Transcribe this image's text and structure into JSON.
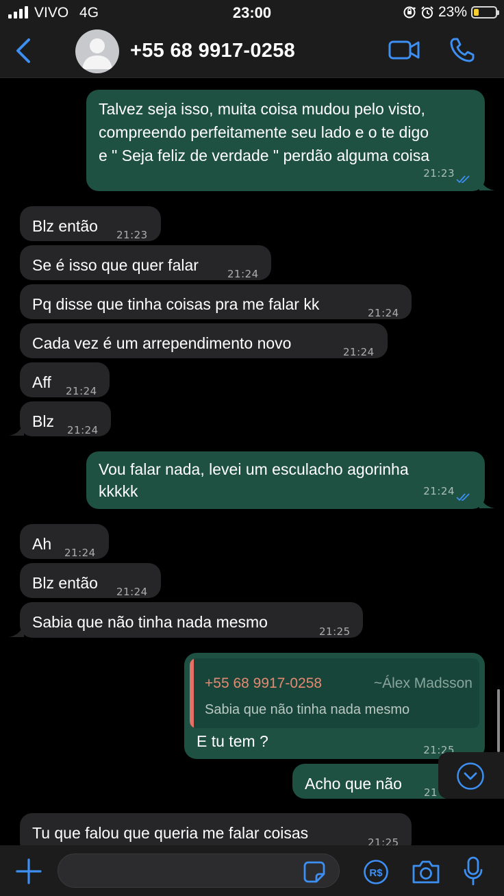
{
  "status_bar": {
    "carrier": "VIVO",
    "network": "4G",
    "time": "23:00",
    "battery_percent_text": "23%",
    "battery_level": 0.23,
    "icons": [
      "signal-icon",
      "orientation-lock-icon",
      "alarm-icon",
      "battery-icon"
    ]
  },
  "header": {
    "contact": "+55 68 9917-0258",
    "icons": [
      "back-icon",
      "avatar",
      "video-call-icon",
      "voice-call-icon"
    ]
  },
  "messages": [
    {
      "dir": "out",
      "lines": [
        "Talvez seja isso, muita coisa mudou pelo visto,",
        "compreendo perfeitamente seu lado e o te digo",
        "e \" Seja feliz de verdade \" perdão alguma coisa"
      ],
      "time": "21:23"
    },
    {
      "dir": "in",
      "lines": [
        "Blz então"
      ],
      "time": "21:23"
    },
    {
      "dir": "in",
      "lines": [
        "Se é isso que quer falar"
      ],
      "time": "21:24"
    },
    {
      "dir": "in",
      "lines": [
        "Pq disse que tinha coisas pra me falar kk"
      ],
      "time": "21:24"
    },
    {
      "dir": "in",
      "lines": [
        "Cada vez é um arrependimento novo"
      ],
      "time": "21:24"
    },
    {
      "dir": "in",
      "lines": [
        "Aff"
      ],
      "time": "21:24"
    },
    {
      "dir": "in",
      "lines": [
        "Blz"
      ],
      "time": "21:24"
    },
    {
      "dir": "out",
      "lines": [
        "Vou  falar nada, levei um esculacho agorinha",
        "kkkkk"
      ],
      "time": "21:24"
    },
    {
      "dir": "in",
      "lines": [
        "Ah"
      ],
      "time": "21:24"
    },
    {
      "dir": "in",
      "lines": [
        "Blz então"
      ],
      "time": "21:24"
    },
    {
      "dir": "in",
      "lines": [
        "Sabia que não tinha nada mesmo"
      ],
      "time": "21:25"
    },
    {
      "dir": "out",
      "quote": {
        "name": "+55 68 9917-0258",
        "alias": "~Álex Madsson",
        "text": "Sabia que não tinha nada mesmo"
      },
      "lines": [
        "E tu tem ?"
      ],
      "time": "21:25"
    },
    {
      "dir": "out",
      "lines": [
        "Acho que não"
      ],
      "time": "21"
    },
    {
      "dir": "in",
      "lines": [
        "Tu que falou que queria me falar coisas"
      ],
      "time": "21:25"
    }
  ],
  "input_bar": {
    "placeholder": "",
    "icons": [
      "plus-icon",
      "sticker-icon",
      "payment-icon",
      "camera-icon",
      "microphone-icon"
    ]
  },
  "colors": {
    "outgoing_bubble": "#1f5142",
    "incoming_bubble": "#262628",
    "accent_blue": "#3d8ff2",
    "quote_bar": "#e57065"
  }
}
